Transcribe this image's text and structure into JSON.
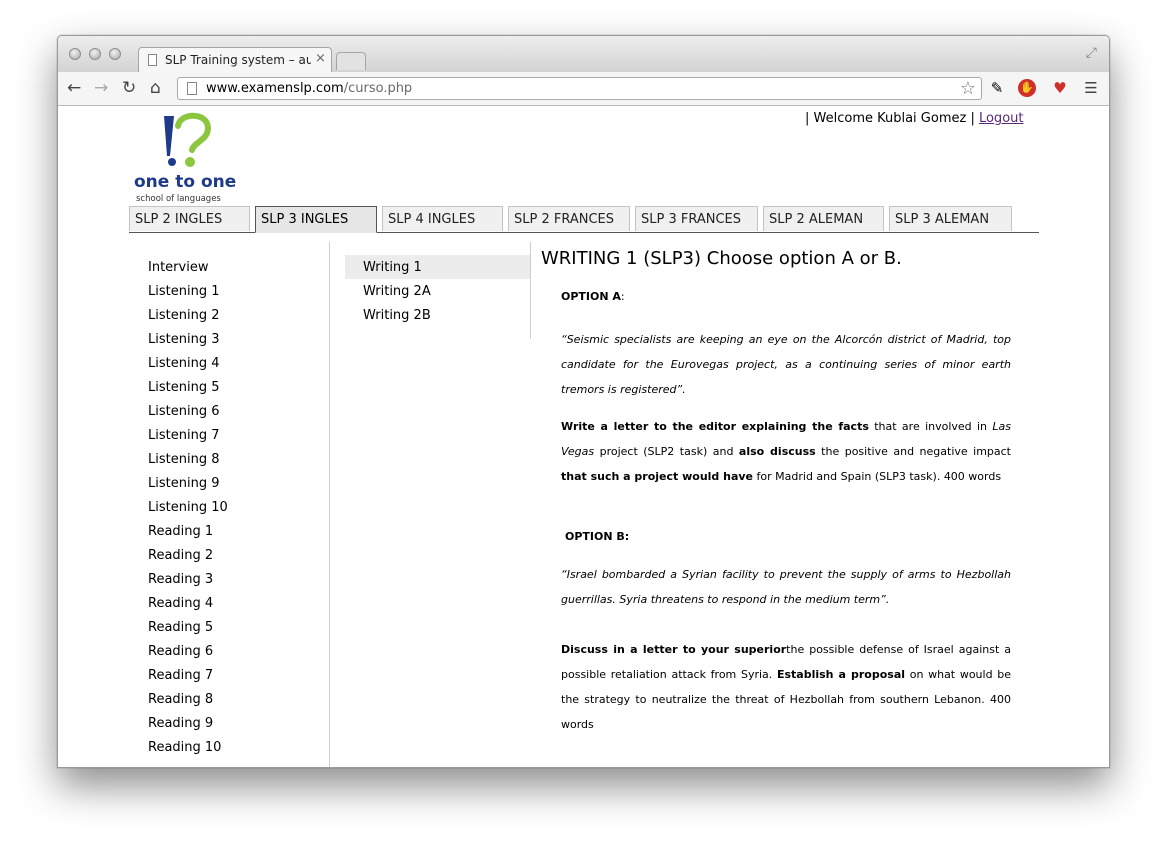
{
  "browser": {
    "tab_title": "SLP Training system – aula",
    "tab_close": "×",
    "url_domain": "www.examenslp.com",
    "url_path": "/curso.php",
    "icons": [
      "back-icon",
      "forward-icon",
      "reload-icon",
      "home-icon",
      "page-icon",
      "star-icon",
      "eyedropper-icon",
      "stop-extension-icon",
      "heart-extension-icon",
      "menu-icon"
    ]
  },
  "header": {
    "logo_line1": "one to one",
    "logo_line2": "school of languages",
    "welcome_prefix": "| Welcome Kublai Gomez |",
    "logout": "Logout"
  },
  "course_tabs": [
    {
      "label": "SLP 2 INGLES",
      "active": false
    },
    {
      "label": "SLP 3 INGLES",
      "active": true
    },
    {
      "label": "SLP 4 INGLES",
      "active": false
    },
    {
      "label": "SLP 2 FRANCES",
      "active": false
    },
    {
      "label": "SLP 3 FRANCES",
      "active": false
    },
    {
      "label": "SLP 2 ALEMAN",
      "active": false
    },
    {
      "label": "SLP 3 ALEMAN",
      "active": false
    }
  ],
  "sidebar": {
    "items": [
      "Interview",
      "Listening 1",
      "Listening 2",
      "Listening 3",
      "Listening 4",
      "Listening 5",
      "Listening 6",
      "Listening 7",
      "Listening 8",
      "Listening 9",
      "Listening 10",
      "Reading 1",
      "Reading 2",
      "Reading 3",
      "Reading 4",
      "Reading 5",
      "Reading 6",
      "Reading 7",
      "Reading 8",
      "Reading 9",
      "Reading 10"
    ]
  },
  "subnav": {
    "items": [
      "Writing 1",
      "Writing 2A",
      "Writing 2B"
    ],
    "active": "Writing 1"
  },
  "main": {
    "title": "WRITING 1 (SLP3) Choose option A or B.",
    "option_a_label": "OPTION A",
    "option_a_colon": ":",
    "option_a_quote": "“Seismic specialists are keeping an eye on the Alcorcón district of Madrid, top candidate for the Eurovegas project, as a continuing series of minor earth tremors is registered”.",
    "option_a_task_b1": "Write a letter to the editor explaining the facts",
    "option_a_task_t1": " that are involved in ",
    "option_a_task_i1": "Las Vegas",
    "option_a_task_t2": " project (SLP2 task) and ",
    "option_a_task_b2": "also discuss",
    "option_a_task_t3": " the positive and negative impact ",
    "option_a_task_b3": "that such a project would have",
    "option_a_task_t4": " for Madrid and Spain (SLP3 task). 400 words",
    "option_b_label": "OPTION B:",
    "option_b_quote": "“Israel bombarded a Syrian facility to prevent the supply of arms to Hezbollah guerrillas. Syria threatens to respond in the medium term”.",
    "option_b_task_b1": "Discuss in a letter to your superior",
    "option_b_task_t1": "the possible defense of Israel against a possible retaliation attack from Syria. ",
    "option_b_task_b2": "Establish a proposal",
    "option_b_task_t2": " on what would be the strategy to neutralize the threat of Hezbollah from southern Lebanon. 400 words"
  }
}
